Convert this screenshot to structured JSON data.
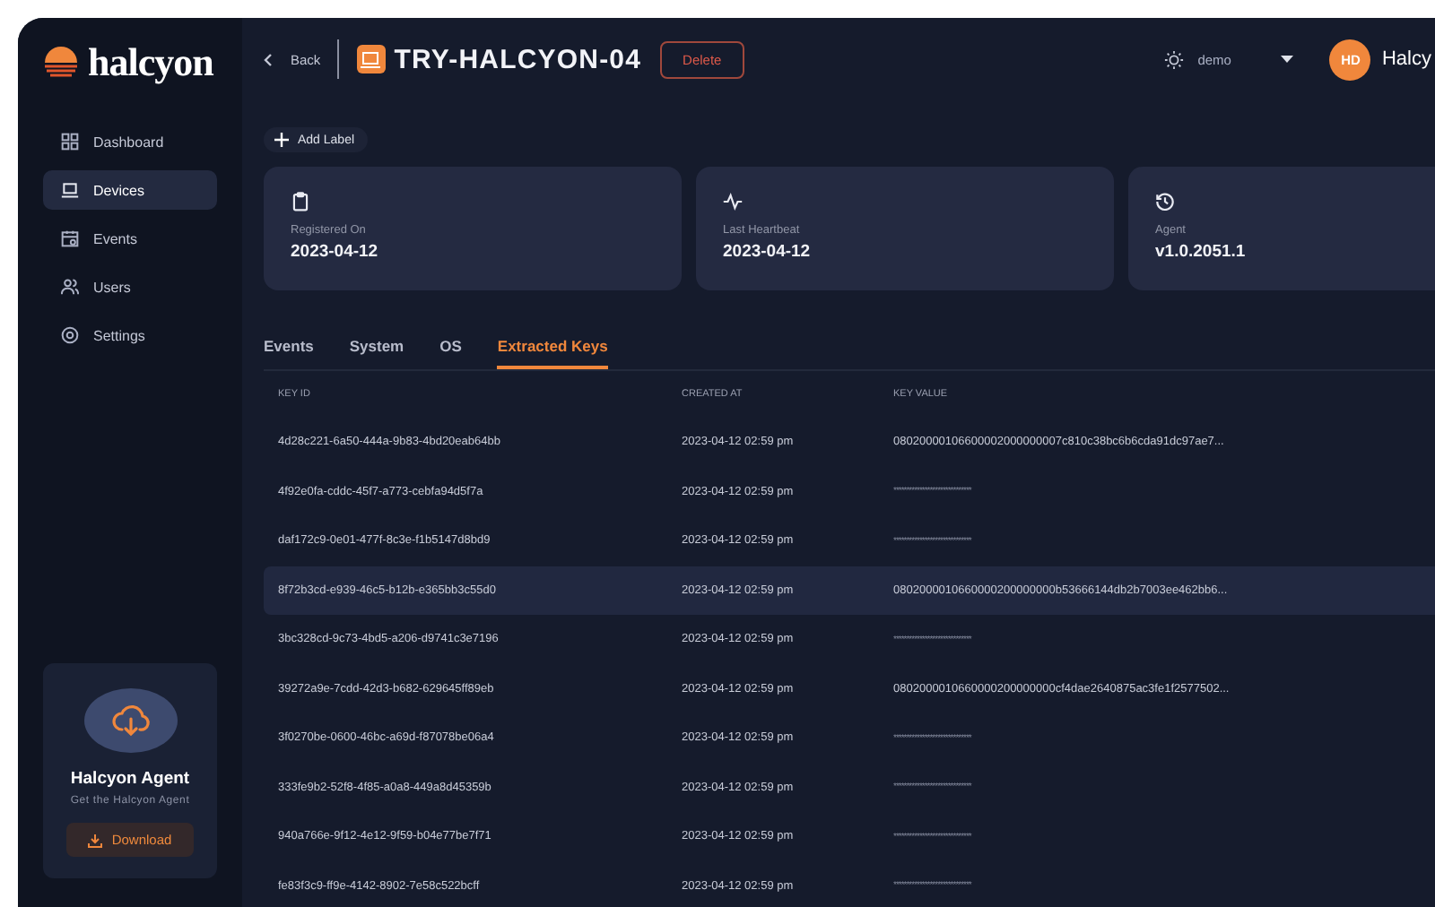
{
  "sidebar": {
    "logo": "halcyon",
    "items": [
      {
        "label": "Dashboard",
        "selected": false
      },
      {
        "label": "Devices",
        "selected": true
      },
      {
        "label": "Events",
        "selected": false
      },
      {
        "label": "Users",
        "selected": false
      },
      {
        "label": "Settings",
        "selected": false
      }
    ],
    "agent_card": {
      "title": "Halcyon Agent",
      "subtitle": "Get the Halcyon Agent",
      "button": "Download"
    }
  },
  "header": {
    "back": "Back",
    "title": "TRY-HALCYON-04",
    "delete": "Delete",
    "theme_label": "demo",
    "avatar": "HD",
    "user": "Halcy"
  },
  "add_label": "Add Label",
  "cards": [
    {
      "label": "Registered On",
      "value": "2023-04-12"
    },
    {
      "label": "Last Heartbeat",
      "value": "2023-04-12"
    },
    {
      "label": "Agent",
      "value": "v1.0.2051.1"
    }
  ],
  "tabs": [
    {
      "label": "Events",
      "selected": false
    },
    {
      "label": "System",
      "selected": false
    },
    {
      "label": "OS",
      "selected": false
    },
    {
      "label": "Extracted Keys",
      "selected": true
    }
  ],
  "table": {
    "columns": [
      "KEY ID",
      "CREATED AT",
      "KEY VALUE"
    ],
    "rows": [
      {
        "cells": [
          "4d28c221-6a50-444a-9b83-4bd20eab64bb",
          "2023-04-12 02:59 pm",
          "08020000106600002000000007c810c38bc6b6cda91dc97ae7..."
        ],
        "masked": false,
        "selected": false
      },
      {
        "cells": [
          "4f92e0fa-cddc-45f7-a773-cebfa94d5f7a",
          "2023-04-12 02:59 pm",
          "******************************"
        ],
        "masked": true,
        "selected": false
      },
      {
        "cells": [
          "daf172c9-0e01-477f-8c3e-f1b5147d8bd9",
          "2023-04-12 02:59 pm",
          "******************************"
        ],
        "masked": true,
        "selected": false
      },
      {
        "cells": [
          "8f72b3cd-e939-46c5-b12b-e365bb3c55d0",
          "2023-04-12 02:59 pm",
          "0802000010660000200000000b53666144db2b7003ee462bb6..."
        ],
        "masked": false,
        "selected": true
      },
      {
        "cells": [
          "3bc328cd-9c73-4bd5-a206-d9741c3e7196",
          "2023-04-12 02:59 pm",
          "******************************"
        ],
        "masked": true,
        "selected": false
      },
      {
        "cells": [
          "39272a9e-7cdd-42d3-b682-629645ff89eb",
          "2023-04-12 02:59 pm",
          "0802000010660000200000000cf4dae2640875ac3fe1f2577502..."
        ],
        "masked": false,
        "selected": false
      },
      {
        "cells": [
          "3f0270be-0600-46bc-a69d-f87078be06a4",
          "2023-04-12 02:59 pm",
          "******************************"
        ],
        "masked": true,
        "selected": false
      },
      {
        "cells": [
          "333fe9b2-52f8-4f85-a0a8-449a8d45359b",
          "2023-04-12 02:59 pm",
          "******************************"
        ],
        "masked": true,
        "selected": false
      },
      {
        "cells": [
          "940a766e-9f12-4e12-9f59-b04e77be7f71",
          "2023-04-12 02:59 pm",
          "******************************"
        ],
        "masked": true,
        "selected": false
      },
      {
        "cells": [
          "fe83f3c9-ff9e-4142-8902-7e58c522bcff",
          "2023-04-12 02:59 pm",
          "******************************"
        ],
        "masked": true,
        "selected": false
      }
    ]
  }
}
